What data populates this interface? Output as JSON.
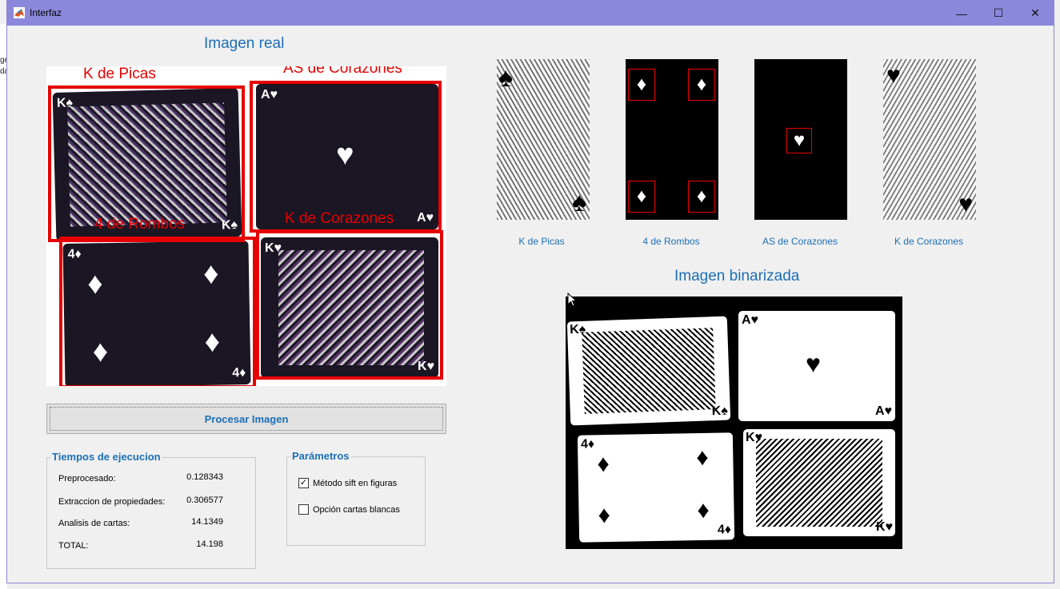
{
  "window": {
    "title": "Interfaz",
    "minimize": "—",
    "maximize": "☐",
    "close": "✕"
  },
  "desktop": {
    "frag1": "ge",
    "frag2": "da"
  },
  "headings": {
    "real": "Imagen real",
    "binarized": "Imagen binarizada"
  },
  "real_image": {
    "labels": [
      "K de Picas",
      "AS de Corazones",
      "4 de Rombos",
      "K de Corazones"
    ]
  },
  "thumbnails": [
    {
      "label": "K de Picas"
    },
    {
      "label": "4 de Rombos"
    },
    {
      "label": "AS de Corazones"
    },
    {
      "label": "K de Corazones"
    }
  ],
  "process_button": {
    "label": "Procesar Imagen"
  },
  "timings": {
    "title": "Tiempos de ejecucion",
    "rows": [
      {
        "label": "Preprocesado:",
        "value": "0.128343"
      },
      {
        "label": "Extraccion de propiedades:",
        "value": "0.306577"
      },
      {
        "label": "Analisis de cartas:",
        "value": "14.1349"
      },
      {
        "label": "TOTAL:",
        "value": "14.198"
      }
    ]
  },
  "params": {
    "title": "Parámetros",
    "options": [
      {
        "label": "Método sift en figuras",
        "checked": true,
        "mark": "✓"
      },
      {
        "label": "Opción cartas blancas",
        "checked": false,
        "mark": ""
      }
    ]
  },
  "colors": {
    "accent": "#1c6fb8",
    "detection": "#e60000",
    "titlebar": "#8b88db"
  }
}
